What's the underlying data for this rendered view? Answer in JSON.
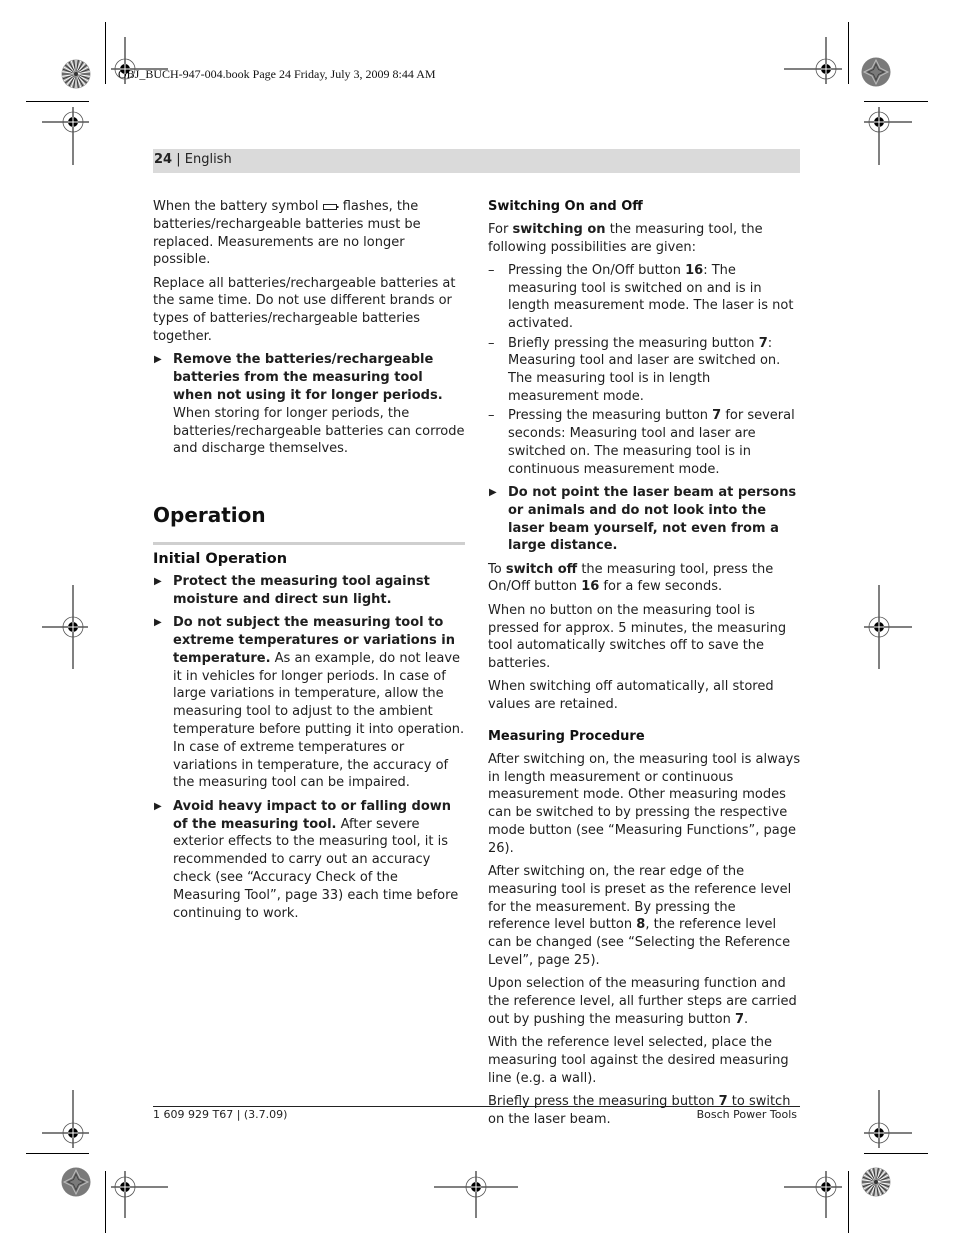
{
  "slug": "OBJ_BUCH-947-004.book  Page 24  Friday, July 3, 2009  8:44 AM",
  "header": {
    "page_number": "24",
    "separator": " | ",
    "language": "English"
  },
  "left_column": {
    "p1_a": "When the battery symbol ",
    "p1_icon": "battery-icon",
    "p1_b": " flashes, the batteries/rechargeable batteries must be replaced. Measurements are no longer possible.",
    "p2": "Replace all batteries/rechargeable batteries at the same time. Do not use different brands or types of batteries/rechargeable batteries together.",
    "b1_bold": "Remove the batteries/rechargeable batteries from the measuring tool when not using it for longer periods.",
    "b1_text": " When storing for longer periods, the batteries/rechargeable batteries can corrode and discharge themselves.",
    "section_title": "Operation",
    "subsection_title": "Initial Operation",
    "b2_bold": "Protect the measuring tool against moisture and direct sun light.",
    "b3_bold": "Do not subject the measuring tool to extreme temperatures or variations in temperature.",
    "b3_text": " As an example, do not leave it in vehicles for longer periods. In case of large variations in temperature, allow the measuring tool to adjust to the ambient temperature before putting it into operation. In case of extreme temperatures or variations in temperature, the accuracy of the measuring tool can be impaired.",
    "b4_bold": "Avoid heavy impact to or falling down of the measuring tool.",
    "b4_text": " After severe exterior effects to the measuring tool, it is recommended to carry out an accuracy check (see “Accuracy Check of the Measuring Tool”, page 33) each time before continuing to work."
  },
  "right_column": {
    "h1": "Switching On and Off",
    "p1_a": "For ",
    "p1_bold": "switching on",
    "p1_b": " the measuring tool, the following possibilities are given:",
    "d1_a": "Pressing the On/Off button ",
    "d1_bold": "16",
    "d1_b": ": The measuring tool is switched on and is in length measurement mode. The laser is not activated.",
    "d2_a": "Briefly pressing the measuring button ",
    "d2_bold": "7",
    "d2_b": ": Measuring tool and laser are switched on. The measuring tool is in length measurement mode.",
    "d3_a": "Pressing the measuring button ",
    "d3_bold": "7",
    "d3_b": " for several seconds: Measuring tool and laser are switched on. The measuring tool is in continuous measurement mode.",
    "warn_bold": "Do not point the laser beam at persons or animals and do not look into the laser beam yourself, not even from a large distance.",
    "p2_a": "To ",
    "p2_bold": "switch off",
    "p2_b": " the measuring tool, press the On/Off button ",
    "p2_bold2": "16",
    "p2_c": " for a few seconds.",
    "p3": "When no button on the measuring tool is pressed for approx. 5 minutes, the measuring tool automatically switches off to save the batteries.",
    "p4": "When switching off automatically, all stored values are retained.",
    "h2": "Measuring Procedure",
    "p5": "After switching on, the measuring tool is always in length measurement or continuous measurement mode. Other measuring modes can be switched to by pressing the respective mode button (see “Measuring Functions”, page 26).",
    "p6_a": "After switching on, the rear edge of the measuring tool is preset as the reference level for the measurement. By pressing the reference level button ",
    "p6_bold": "8",
    "p6_b": ", the reference level can be changed (see “Selecting the Reference Level”, page 25).",
    "p7_a": "Upon selection of the measuring function and the reference level, all further steps are carried out by pushing the measuring button ",
    "p7_bold": "7",
    "p7_b": ".",
    "p8": "With the reference level selected, place the measuring tool against the desired measuring line (e.g. a wall).",
    "p9_a": "Briefly press the measuring button ",
    "p9_bold": "7",
    "p9_b": " to switch on the laser beam."
  },
  "footer": {
    "left": "1 609 929 T67 | (3.7.09)",
    "right": "Bosch Power Tools"
  },
  "glyphs": {
    "bullet": "▶",
    "dash": "–"
  }
}
